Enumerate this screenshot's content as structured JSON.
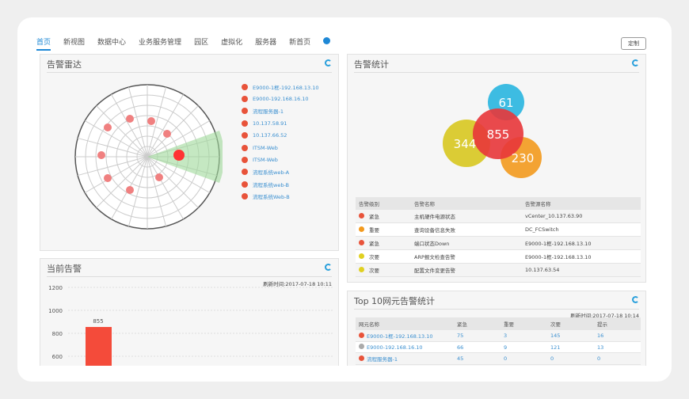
{
  "nav": {
    "tabs": [
      "首页",
      "新视图",
      "数据中心",
      "业务服务管理",
      "园区",
      "虚拟化",
      "服务器",
      "新首页"
    ],
    "custom_label": "定制"
  },
  "radar": {
    "title": "告警雷达",
    "items": [
      "E9000-1框-192.168.13.10",
      "E9000-192.168.16.10",
      "流程服务器-1",
      "10.137.58.91",
      "10.137.66.52",
      "ITSM-Web",
      "ITSM-Web",
      "流程系统web-A",
      "流程系统web-B",
      "流程系统Web-B"
    ]
  },
  "stats": {
    "title": "告警统计",
    "venn": [
      {
        "value": "61",
        "color": "#29b6e0"
      },
      {
        "value": "855",
        "color": "#e8363a"
      },
      {
        "value": "344",
        "color": "#d8c820"
      },
      {
        "value": "230",
        "color": "#f39a1e"
      }
    ],
    "headers": [
      "告警级别",
      "告警名称",
      "告警源名称"
    ],
    "rows": [
      {
        "level": "紧急",
        "color": "#e8533a",
        "name": "主机硬件电源状态",
        "source": "vCenter_10.137.63.90"
      },
      {
        "level": "重要",
        "color": "#f39a1e",
        "name": "查询设备信息失败",
        "source": "DC_FCSwitch"
      },
      {
        "level": "紧急",
        "color": "#e8533a",
        "name": "端口状态Down",
        "source": "E9000-1框-192.168.13.10"
      },
      {
        "level": "次要",
        "color": "#e0d020",
        "name": "ARP报文检查告警",
        "source": "E9000-1框-192.168.13.10"
      },
      {
        "level": "次要",
        "color": "#e0d020",
        "name": "配置文件变更告警",
        "source": "10.137.63.54"
      }
    ]
  },
  "current": {
    "title": "当前告警",
    "time": "刷新时间:2017-07-18 10:11"
  },
  "chart_data": {
    "type": "bar",
    "yticks": [
      1200,
      1000,
      800,
      600
    ],
    "values": [
      855
    ],
    "color": "#f44b3a"
  },
  "top10": {
    "title": "Top 10网元告警统计",
    "time": "刷新时间:2017-07-18 10:14",
    "headers": [
      "网元名称",
      "紧急",
      "重要",
      "次要",
      "提示"
    ],
    "rows": [
      {
        "name": "E9000-1框-192.168.13.10",
        "color": "#e8533a",
        "v": [
          "75",
          "3",
          "145",
          "16"
        ]
      },
      {
        "name": "E9000-192.168.16.10",
        "color": "#aaaaaa",
        "v": [
          "66",
          "9",
          "121",
          "13"
        ]
      },
      {
        "name": "流程服务器-1",
        "color": "#e8533a",
        "v": [
          "45",
          "0",
          "0",
          "0"
        ]
      }
    ]
  }
}
